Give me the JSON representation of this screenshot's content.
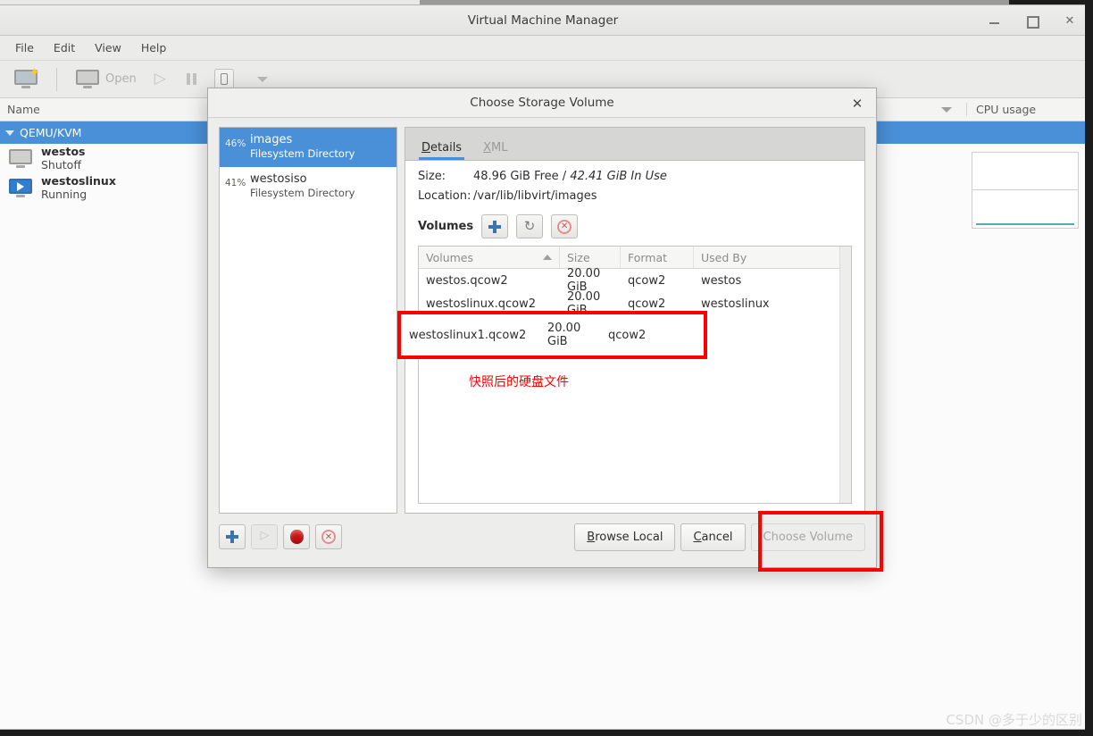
{
  "window": {
    "title": "Virtual Machine Manager",
    "controls": {
      "minimize": "minimize-button",
      "maximize": "maximize-button",
      "close": "✕"
    }
  },
  "menubar": {
    "items": [
      "File",
      "Edit",
      "View",
      "Help"
    ]
  },
  "toolbar": {
    "new_vm_icon": "new-vm-icon",
    "open_label": "Open",
    "buttons": [
      "open-vm-button",
      "run-vm-button",
      "pause-vm-button",
      "shutdown-vm-button",
      "shutdown-options-dropdown"
    ]
  },
  "vm_list": {
    "columns": {
      "name": "Name",
      "cpu": "CPU usage"
    },
    "group": {
      "label": "QEMU/KVM",
      "expanded": true
    },
    "rows": [
      {
        "name": "westos",
        "state": "Shutoff",
        "icon": "monitor-icon"
      },
      {
        "name": "westoslinux",
        "state": "Running",
        "icon": "monitor-running-icon"
      }
    ]
  },
  "dialog": {
    "title": "Choose Storage Volume",
    "close_glyph": "✕",
    "pools": [
      {
        "percent": "46%",
        "name": "images",
        "type": "Filesystem Directory",
        "selected": true
      },
      {
        "percent": "41%",
        "name": "westosiso",
        "type": "Filesystem Directory",
        "selected": false
      }
    ],
    "tabs": [
      {
        "label": "Details",
        "mnemonic": "D",
        "rest": "etails",
        "active": true
      },
      {
        "label": "XML",
        "mnemonic": "X",
        "rest": "ML",
        "active": false
      }
    ],
    "details": {
      "size_label": "Size:",
      "size_free": "48.96 GiB Free /",
      "size_inuse": "42.41 GiB In Use",
      "location_label": "Location:",
      "location_value": "/var/lib/libvirt/images"
    },
    "volumes_section": {
      "label": "Volumes",
      "actions": [
        "add-volume-button",
        "refresh-volumes-button",
        "delete-volume-button"
      ]
    },
    "volumes_table": {
      "columns": [
        "Volumes",
        "Size",
        "Format",
        "Used By"
      ],
      "sort_column": "Volumes",
      "sort_direction": "ascending",
      "rows": [
        {
          "name": "westos.qcow2",
          "size": "20.00 GiB",
          "format": "qcow2",
          "used_by": "westos"
        },
        {
          "name": "westoslinux.qcow2",
          "size": "20.00 GiB",
          "format": "qcow2",
          "used_by": "westoslinux"
        },
        {
          "name": "westoslinux1.qcow2",
          "size": "20.00 GiB",
          "format": "qcow2",
          "used_by": ""
        }
      ]
    },
    "annotation_cn": "快照后的硬盘文件",
    "pool_actions": [
      "add-pool-button",
      "start-pool-button",
      "stop-pool-button",
      "delete-pool-button"
    ],
    "footer": {
      "browse_local": {
        "mnemonic": "B",
        "rest": "rowse Local"
      },
      "cancel": {
        "mnemonic": "C",
        "rest": "ancel"
      },
      "choose_volume": {
        "label": "Choose Volume",
        "disabled": true
      }
    }
  },
  "annotations": {
    "highlight_color": "#fd0000",
    "boxes": [
      "volume-row-highlight",
      "choose-volume-highlight"
    ]
  },
  "watermark": "CSDN @多于少的区别",
  "colors": {
    "accent": "#4a90d9",
    "highlight": "#fd0000",
    "chrome": "#ededeb"
  }
}
